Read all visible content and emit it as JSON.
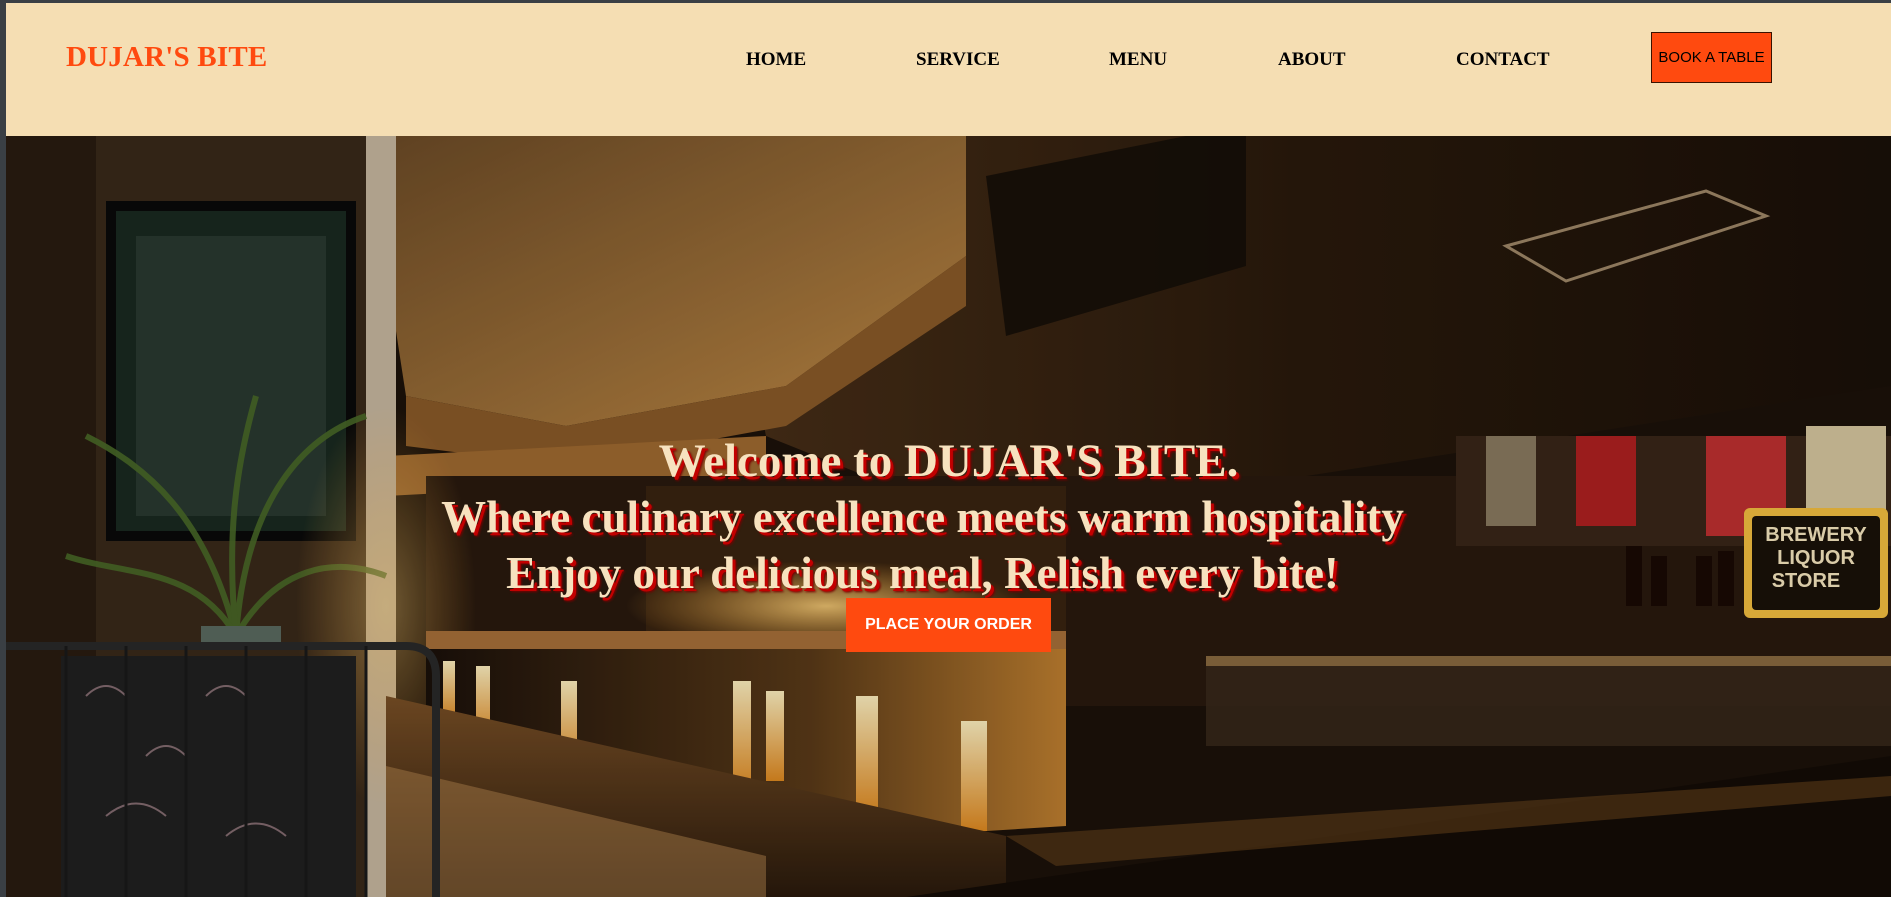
{
  "header": {
    "logo": "DUJAR'S BITE",
    "nav": {
      "home": "HOME",
      "service": "SERVICE",
      "menu": "MENU",
      "about": "ABOUT",
      "contact": "CONTACT"
    },
    "book_button": "BOOK A TABLE"
  },
  "hero": {
    "line1": "Welcome to DUJAR'S BITE.",
    "line2": "Where culinary excellence meets warm hospitality",
    "line3": "Enjoy our delicious meal, Relish every bite!",
    "order_button": "PLACE YOUR ORDER",
    "image_icon": "restaurant-interior-photo"
  },
  "colors": {
    "header_bg": "#f5deb3",
    "accent": "#ff4a0f",
    "hero_text": "#f7e2bf",
    "hero_text_shadow": "#c20000"
  }
}
